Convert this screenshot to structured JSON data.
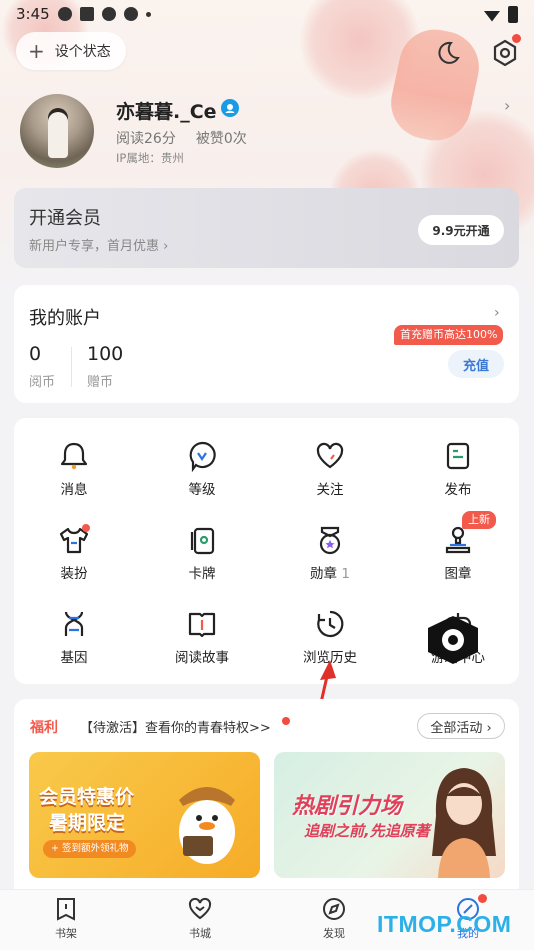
{
  "status_bar": {
    "time": "3:45"
  },
  "header": {
    "status_pill_label": "设个状态"
  },
  "profile": {
    "name": "亦暮暮._Ce",
    "read_time": "阅读26分",
    "likes": "被赞0次",
    "ip_location": "IP属地：贵州"
  },
  "vip": {
    "title": "开通会员",
    "subtitle": "新用户专享，首月优惠",
    "button": "9.9元开通"
  },
  "account": {
    "title": "我的账户",
    "coins": [
      {
        "value": "0",
        "label": "阅币"
      },
      {
        "value": "100",
        "label": "赠币"
      }
    ],
    "promo": "首充赠币高达100%",
    "recharge": "充值"
  },
  "menu": {
    "items": [
      {
        "label": "消息",
        "icon": "bell-icon"
      },
      {
        "label": "等级",
        "icon": "level-icon"
      },
      {
        "label": "关注",
        "icon": "heart-icon"
      },
      {
        "label": "发布",
        "icon": "publish-icon"
      },
      {
        "label": "装扮",
        "icon": "shirt-icon"
      },
      {
        "label": "卡牌",
        "icon": "card-icon"
      },
      {
        "label": "勋章",
        "icon": "medal-icon",
        "count": "1"
      },
      {
        "label": "图章",
        "icon": "stamp-icon",
        "badge": "上新"
      },
      {
        "label": "基因",
        "icon": "dna-icon"
      },
      {
        "label": "阅读故事",
        "icon": "book-icon"
      },
      {
        "label": "浏览历史",
        "icon": "clock-icon"
      },
      {
        "label": "游戏中心",
        "icon": "gamepad-icon"
      }
    ]
  },
  "welfare": {
    "tag": "福利",
    "text": "【待激活】查看你的青春特权>>",
    "all_button": "全部活动 ›",
    "banners": [
      {
        "line1": "会员特惠价",
        "line2": "暑期限定",
        "sub": "+ 签到额外领礼物"
      },
      {
        "line1": "热剧引力场",
        "line2": "追剧之前,先追原著"
      }
    ]
  },
  "bottom_nav": [
    {
      "label": "书架",
      "icon": "bookshelf-icon"
    },
    {
      "label": "书城",
      "icon": "bookstore-icon"
    },
    {
      "label": "发现",
      "icon": "compass-icon"
    },
    {
      "label": "我的",
      "icon": "profile-icon",
      "active": true
    }
  ],
  "watermark": "ITMOP.COM",
  "colors": {
    "accent_red": "#f25a4c",
    "accent_blue": "#2b73e3",
    "recharge_blue": "#3b7ad4"
  }
}
